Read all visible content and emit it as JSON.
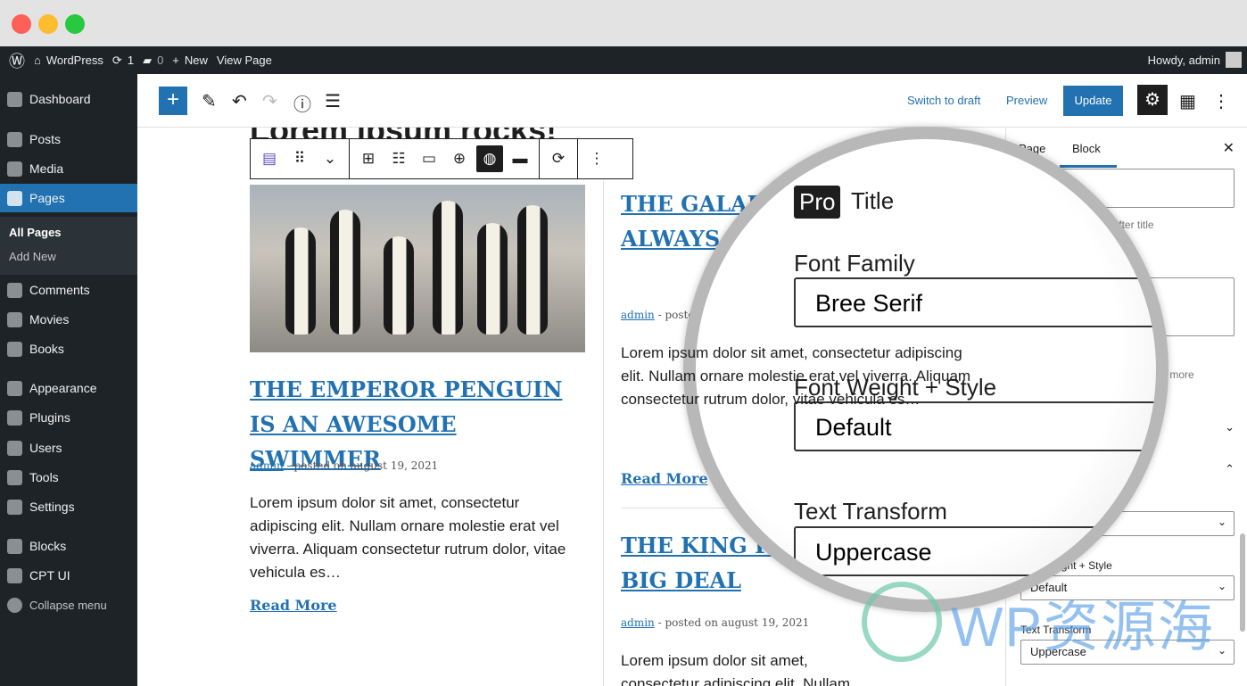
{
  "window": {
    "colors": {
      "close": "#fe5f57",
      "minimize": "#febc2e",
      "zoom": "#28c840"
    }
  },
  "adminbar": {
    "site": "WordPress",
    "updates": "1",
    "comments": "0",
    "new": "New",
    "view": "View Page",
    "howdy": "Howdy, admin"
  },
  "sidebar": {
    "items": [
      {
        "label": "Dashboard"
      },
      {
        "label": "Posts"
      },
      {
        "label": "Media"
      },
      {
        "label": "Pages"
      },
      {
        "label": "Comments"
      },
      {
        "label": "Movies"
      },
      {
        "label": "Books"
      },
      {
        "label": "Appearance"
      },
      {
        "label": "Plugins"
      },
      {
        "label": "Users"
      },
      {
        "label": "Tools"
      },
      {
        "label": "Settings"
      },
      {
        "label": "Blocks"
      },
      {
        "label": "CPT UI"
      },
      {
        "label": "Collapse menu"
      }
    ],
    "sub": [
      "All Pages",
      "Add New"
    ]
  },
  "header": {
    "switch_draft": "Switch to draft",
    "preview": "Preview",
    "update": "Update"
  },
  "content": {
    "page_title": "Lorem ipsum rocks!",
    "posts": [
      {
        "title": "The Emperor Penguin is an awesome swimmer",
        "author": "admin",
        "date": "- posted on august 19, 2021",
        "excerpt": "Lorem ipsum dolor sit amet, consectetur adipiscing elit. Nullam ornare molestie erat vel viverra. Aliquam consectetur rutrum dolor, vitae vehicula es…",
        "more": "Read More"
      },
      {
        "title": "The Galapagos penguin always stays cool",
        "author": "admin",
        "date": "- posted on august 19, 2021",
        "excerpt": "Lorem ipsum dolor sit amet, consectetur adipiscing elit. Nullam ornare molestie erat vel viverra. Aliquam consectetur rutrum dolor, vitae vehicula es…",
        "more": "Read More"
      },
      {
        "title": "The King Penguin is a big deal",
        "author": "admin",
        "date": "- posted on august 19, 2021",
        "excerpt": "Lorem ipsum dolor sit amet, consectetur adipiscing elit. Nullam"
      }
    ]
  },
  "panel": {
    "tab_page": "Page",
    "tab_block": "Block",
    "hint1": "ML after title",
    "hint2": "re",
    "hint3": "ead more",
    "weight_label": "nt Weight + Style",
    "weight_value": "Default",
    "transform_label": "Text Transform",
    "transform_value": "Uppercase"
  },
  "magnifier": {
    "badge": "Pro",
    "title": "Title",
    "font_family_label": "Font Family",
    "font_family_value": "Bree Serif",
    "weight_label": "Font Weight + Style",
    "weight_value": "Default",
    "transform_label": "Text Transform",
    "transform_value": "Uppercase"
  },
  "watermark": "WP资源海"
}
